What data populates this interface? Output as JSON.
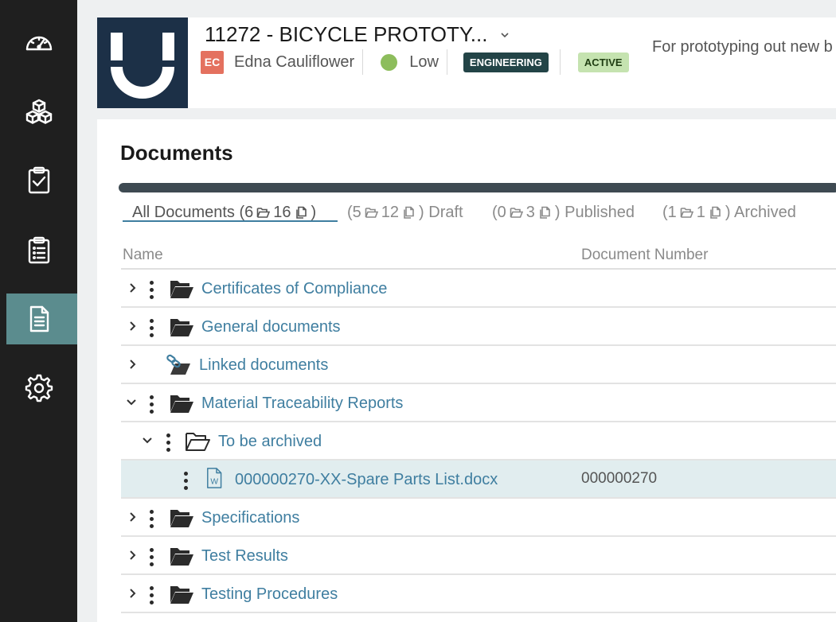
{
  "sidebar": {
    "items": [
      {
        "icon": "dashboard-icon"
      },
      {
        "icon": "cubes-icon"
      },
      {
        "icon": "clipboard-check-icon"
      },
      {
        "icon": "clipboard-list-icon"
      },
      {
        "icon": "document-icon",
        "active": true
      },
      {
        "icon": "gear-icon"
      }
    ]
  },
  "header": {
    "title": "11272 - BICYCLE PROTOTY...",
    "owner_initials": "EC",
    "owner_name": "Edna Cauliflower",
    "priority": "Low",
    "department_badge": "ENGINEERING",
    "status_badge": "ACTIVE",
    "description": "For prototyping out new b"
  },
  "documents": {
    "title": "Documents",
    "tabs": [
      {
        "prefix": "All Documents (",
        "folders": "6",
        "files": "16",
        "suffix": ")"
      },
      {
        "prefix": "(",
        "folders": "5",
        "files": "12",
        "suffix": ") Draft"
      },
      {
        "prefix": "(",
        "folders": "0",
        "files": "3",
        "suffix": ") Published"
      },
      {
        "prefix": "(",
        "folders": "1",
        "files": "1",
        "suffix": ") Archived"
      }
    ],
    "columns": {
      "name": "Name",
      "document_number": "Document Number"
    },
    "rows": [
      {
        "label": "Certificates of Compliance",
        "number": ""
      },
      {
        "label": "General documents",
        "number": ""
      },
      {
        "label": "Linked documents",
        "number": ""
      },
      {
        "label": "Material Traceability Reports",
        "number": ""
      },
      {
        "label": "To be archived",
        "number": ""
      },
      {
        "label": "000000270-XX-Spare Parts List.docx",
        "number": "000000270"
      },
      {
        "label": "Specifications",
        "number": ""
      },
      {
        "label": "Test Results",
        "number": ""
      },
      {
        "label": "Testing Procedures",
        "number": ""
      }
    ]
  },
  "colors": {
    "accent": "#3f7ea0",
    "sidebar_bg": "#1f1f1f",
    "sidebar_active": "#5b8c8e",
    "logo_bg": "#1c3047",
    "avatar": "#e4715f",
    "priority_low": "#8dbd5c",
    "badge_engineering": "#234447",
    "badge_active": "#c5e3b0",
    "row_highlight": "#e1edef"
  }
}
